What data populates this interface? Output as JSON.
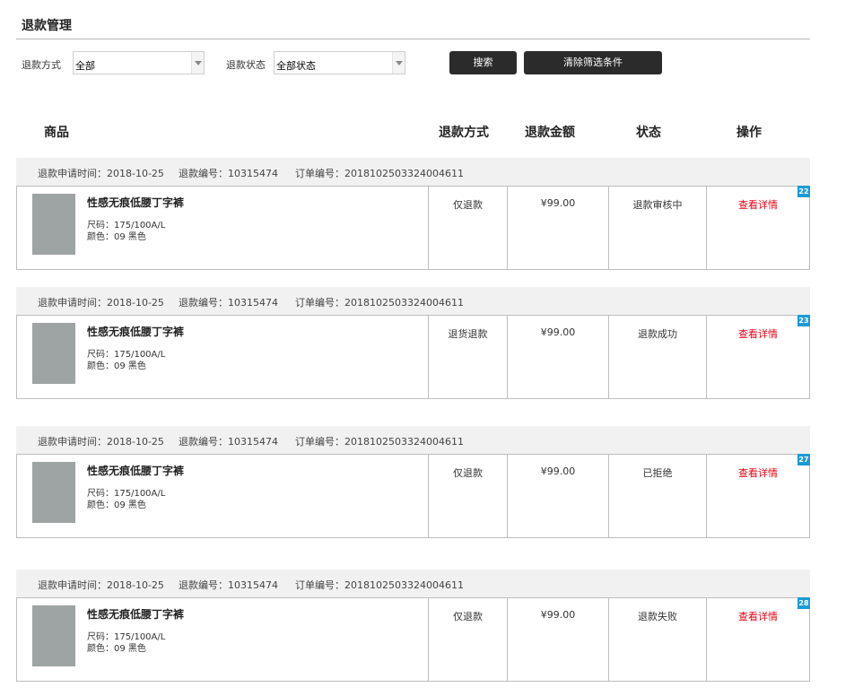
{
  "page_title": "退款管理",
  "filters": {
    "refund_method_label": "退款方式",
    "refund_method_value": "全部",
    "refund_status_label": "退款状态",
    "refund_status_value": "全部状态",
    "search_button": "搜索",
    "clear_button": "清除筛选条件"
  },
  "columns": {
    "product": "商品",
    "method": "退款方式",
    "amount": "退款金额",
    "status": "状态",
    "action": "操作"
  },
  "records": [
    {
      "apply_time": "退款申请时间：2018-10-25",
      "refund_no": "退款编号：10315474",
      "order_no": "订单编号：2018102503324004611",
      "product_name": "性感无痕低腰丁字裤",
      "size": "尺码：175/100A/L",
      "color": "颜色：09 黑色",
      "method": "仅退款",
      "amount": "¥99.00",
      "status": "退款审核中",
      "action": "查看详情",
      "badge": "22"
    },
    {
      "apply_time": "退款申请时间：2018-10-25",
      "refund_no": "退款编号：10315474",
      "order_no": "订单编号：2018102503324004611",
      "product_name": "性感无痕低腰丁字裤",
      "size": "尺码：175/100A/L",
      "color": "颜色：09 黑色",
      "method": "退货退款",
      "amount": "¥99.00",
      "status": "退款成功",
      "action": "查看详情",
      "badge": "23"
    },
    {
      "apply_time": "退款申请时间：2018-10-25",
      "refund_no": "退款编号：10315474",
      "order_no": "订单编号：2018102503324004611",
      "product_name": "性感无痕低腰丁字裤",
      "size": "尺码：175/100A/L",
      "color": "颜色：09 黑色",
      "method": "仅退款",
      "amount": "¥99.00",
      "status": "已拒绝",
      "action": "查看详情",
      "badge": "27"
    },
    {
      "apply_time": "退款申请时间：2018-10-25",
      "refund_no": "退款编号：10315474",
      "order_no": "订单编号：2018102503324004611",
      "product_name": "性感无痕低腰丁字裤",
      "size": "尺码：175/100A/L",
      "color": "颜色：09 黑色",
      "method": "仅退款",
      "amount": "¥99.00",
      "status": "退款失败",
      "action": "查看详情",
      "badge": "28"
    }
  ]
}
